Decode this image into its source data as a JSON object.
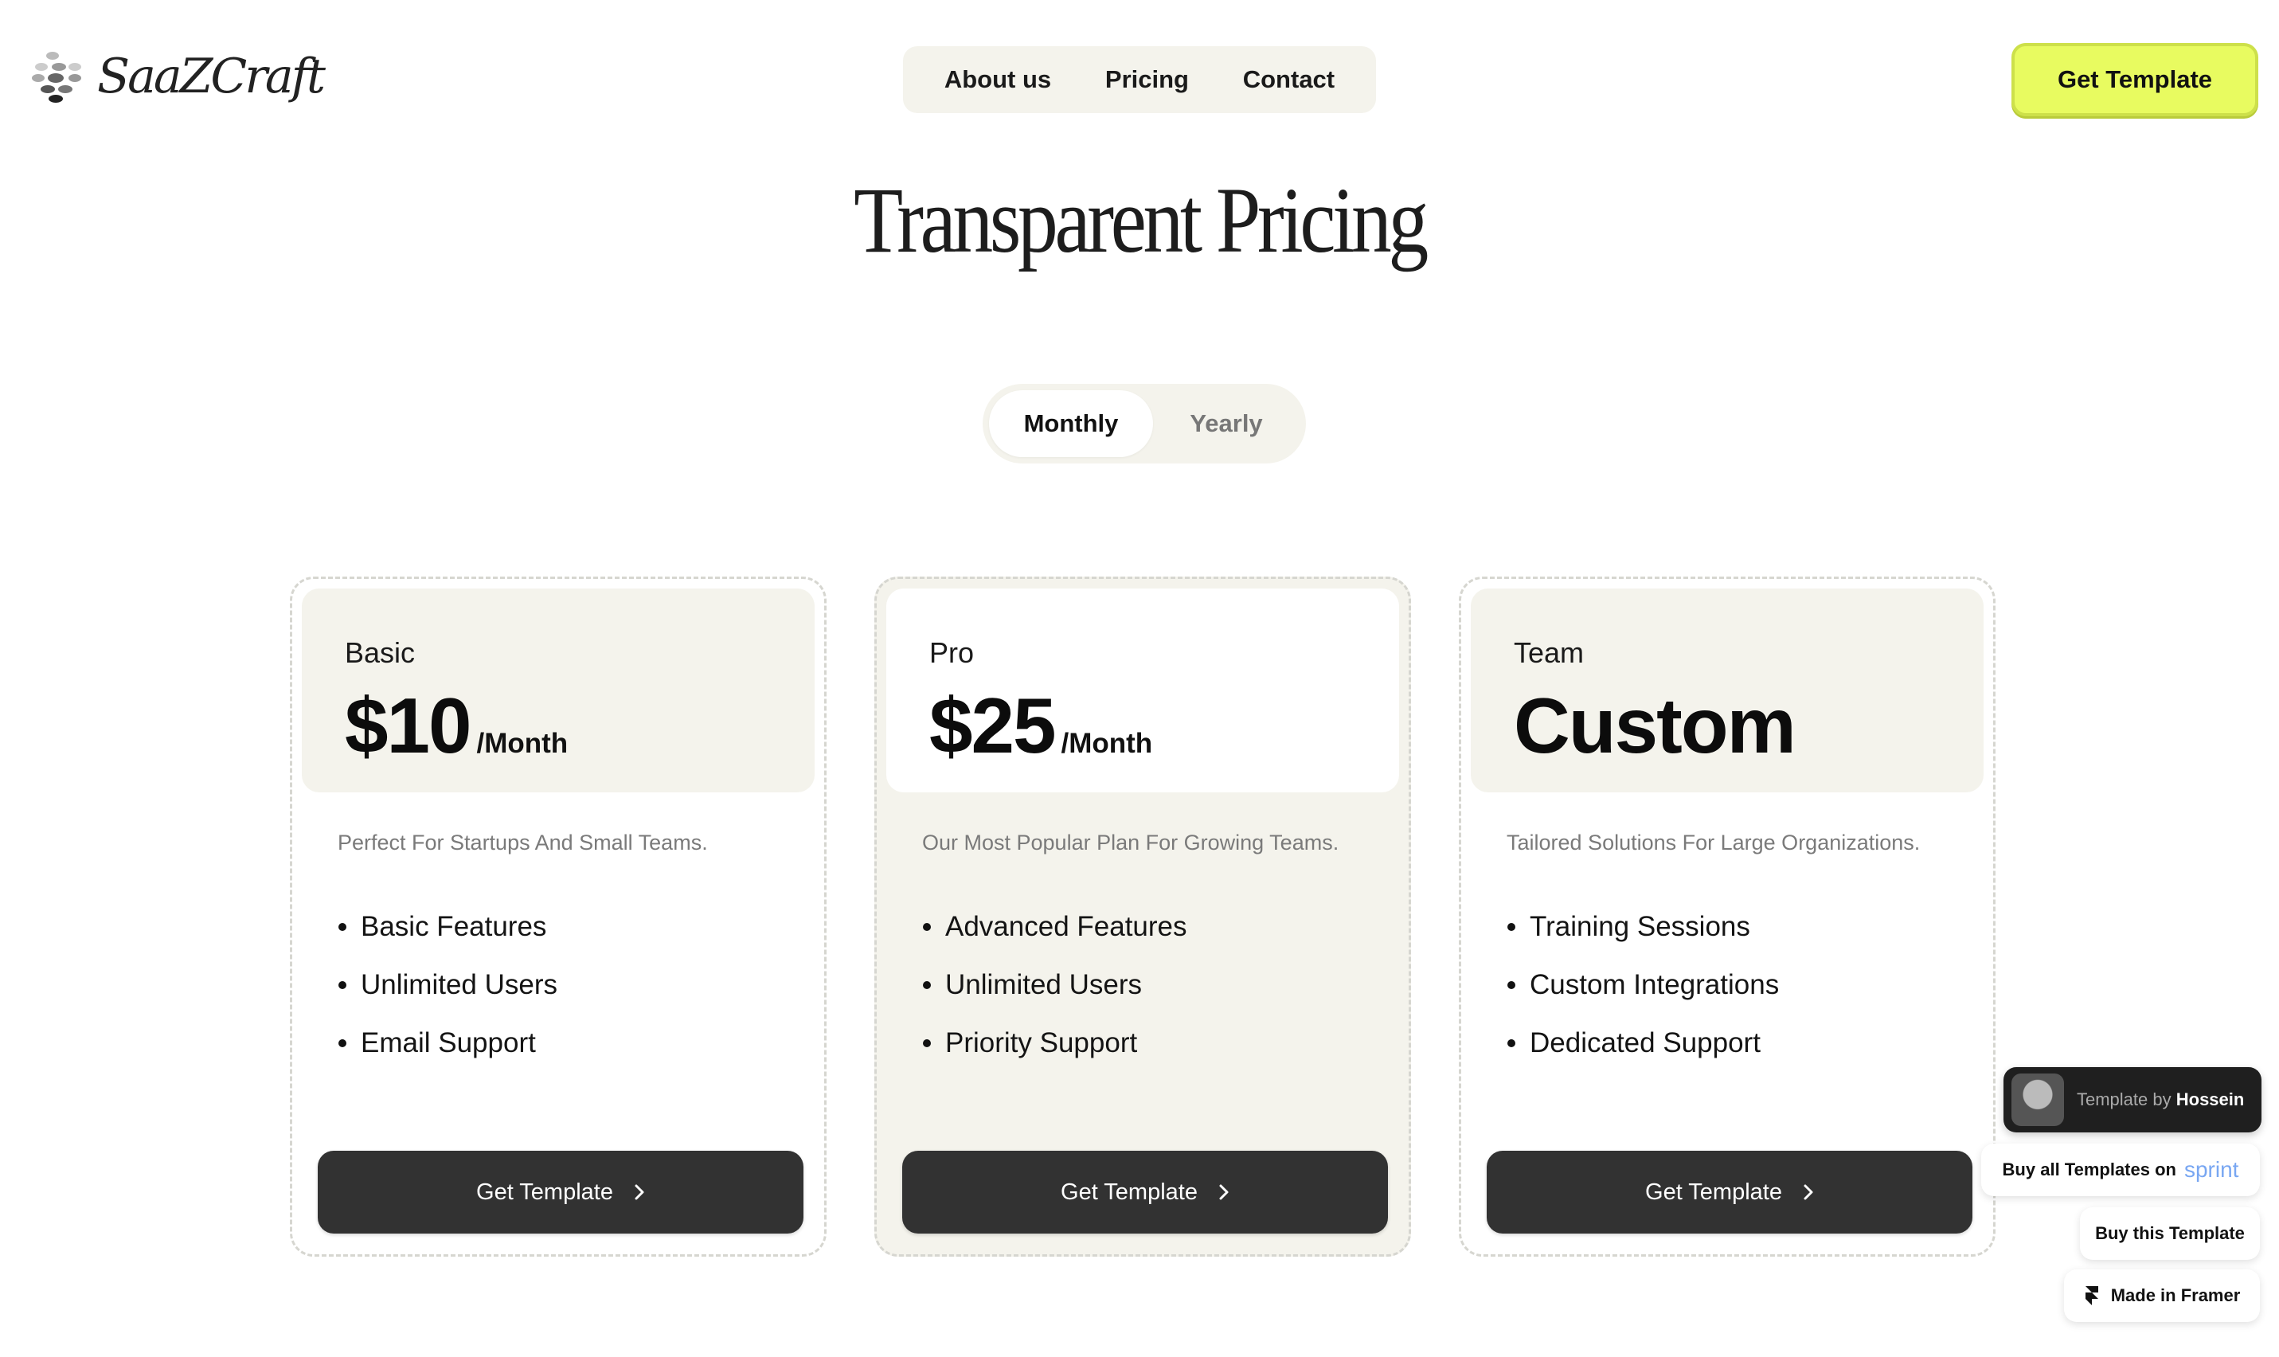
{
  "header": {
    "logo_text": "SaaZCraft",
    "nav": [
      "About us",
      "Pricing",
      "Contact"
    ],
    "cta_label": "Get Template"
  },
  "title": "Transparent Pricing",
  "billing_toggle": {
    "options": [
      "Monthly",
      "Yearly"
    ],
    "selected": "Monthly"
  },
  "plans": [
    {
      "name": "Basic",
      "price": "$10",
      "period": "/Month",
      "description": "Perfect For Startups And Small Teams.",
      "features": [
        "Basic Features",
        "Unlimited Users",
        "Email Support"
      ],
      "button_label": "Get Template"
    },
    {
      "name": "Pro",
      "price": "$25",
      "period": "/Month",
      "description": "Our Most Popular Plan For Growing Teams.",
      "features": [
        "Advanced Features",
        "Unlimited Users",
        "Priority Support"
      ],
      "button_label": "Get Template"
    },
    {
      "name": "Team",
      "price": "Custom",
      "period": "",
      "description": "Tailored Solutions For Large Organizations.",
      "features": [
        "Training Sessions",
        "Custom Integrations",
        "Dedicated Support"
      ],
      "button_label": "Get Template"
    }
  ],
  "badges": {
    "author_prefix": "Template by",
    "author_name": "Hossein",
    "buy_all": "Buy all Templates on",
    "buy_all_brand": "sprint",
    "buy_this": "Buy this Template",
    "made_in": "Made in Framer"
  },
  "colors": {
    "accent": "#e8fb60",
    "card_surface": "#f4f3ec",
    "button_dark": "#323232",
    "text": "#111111"
  }
}
